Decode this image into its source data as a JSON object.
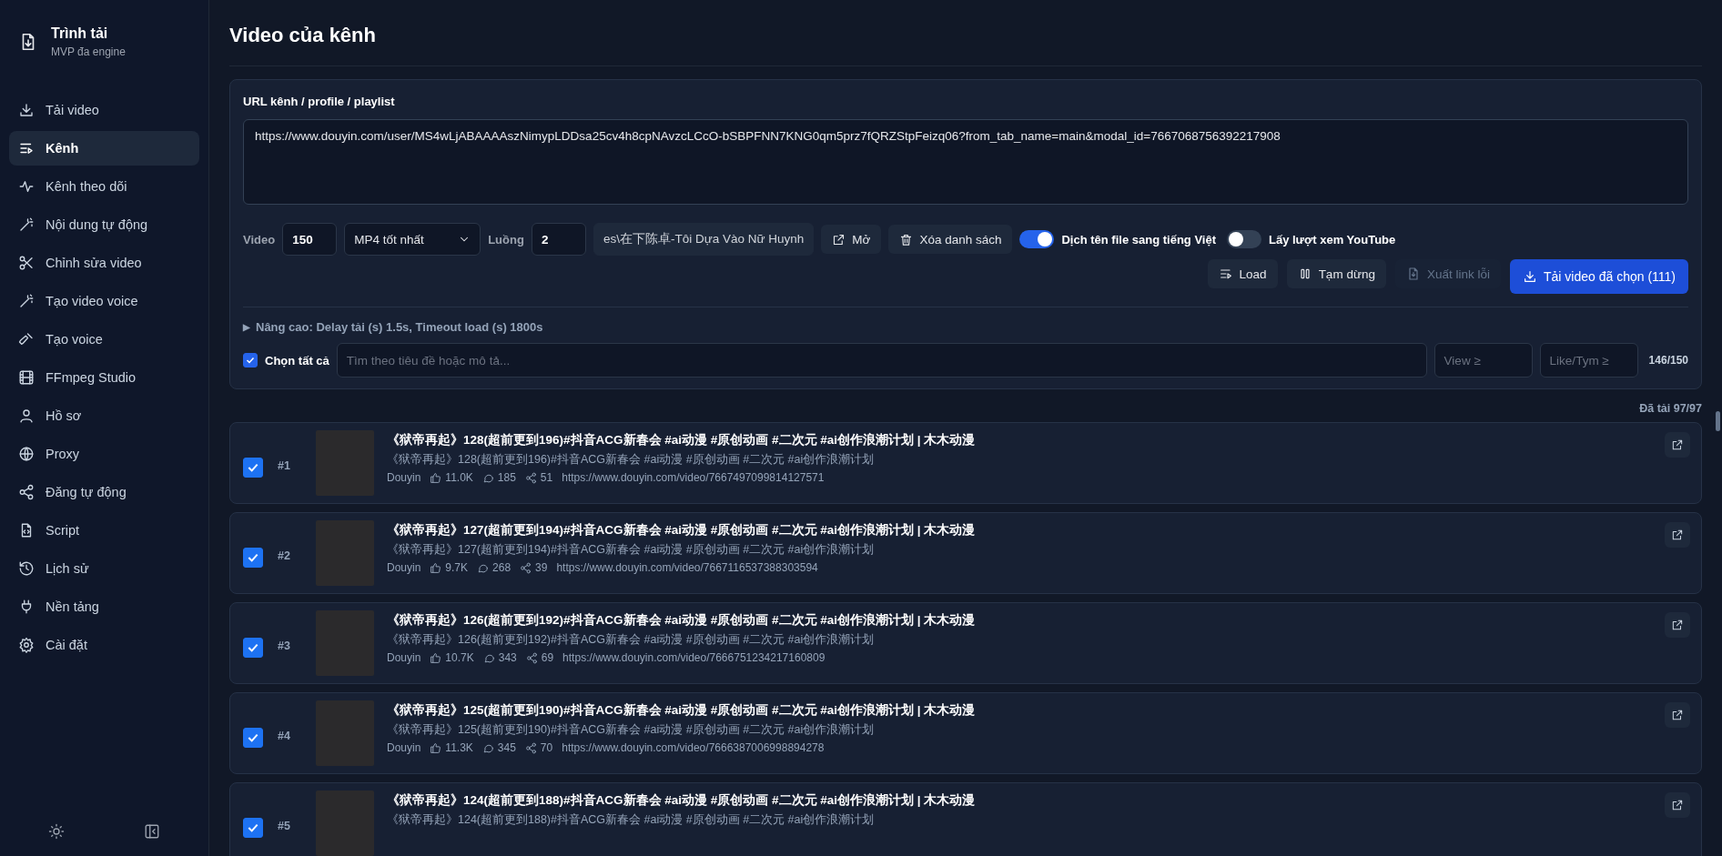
{
  "sidebar": {
    "app_title": "Trình tải",
    "app_subtitle": "MVP đa engine",
    "items": [
      {
        "label": "Tải video",
        "selected": false
      },
      {
        "label": "Kênh",
        "selected": true
      },
      {
        "label": "Kênh theo dõi",
        "selected": false
      },
      {
        "label": "Nội dung tự động",
        "selected": false
      },
      {
        "label": "Chỉnh sửa video",
        "selected": false
      },
      {
        "label": "Tạo video voice",
        "selected": false
      },
      {
        "label": "Tạo voice",
        "selected": false
      },
      {
        "label": "FFmpeg Studio",
        "selected": false
      },
      {
        "label": "Hồ sơ",
        "selected": false
      },
      {
        "label": "Proxy",
        "selected": false
      },
      {
        "label": "Đăng tự động",
        "selected": false
      },
      {
        "label": "Script",
        "selected": false
      },
      {
        "label": "Lịch sử",
        "selected": false
      },
      {
        "label": "Nền tảng",
        "selected": false
      },
      {
        "label": "Cài đặt",
        "selected": false
      }
    ]
  },
  "page_title": "Video của kênh",
  "form": {
    "url_label": "URL kênh / profile / playlist",
    "url_value": "https://www.douyin.com/user/MS4wLjABAAAAszNimypLDDsa25cv4h8cpNAvzcLCcO-bSBPFNN7KNG0qm5prz7fQRZStpFeizq06?from_tab_name=main&modal_id=7667068756392217908",
    "video_label": "Video",
    "video_value": "150",
    "format_value": "MP4 tốt nhất",
    "threads_label": "Luồng",
    "threads_value": "2",
    "folder_value": "es\\在下陈卓-Tôi Dựa Vào Nữ Huynh",
    "open_button": "Mở",
    "clear_button": "Xóa danh sách",
    "toggles": [
      {
        "label": "Dịch tên file sang tiếng Việt",
        "on": true
      },
      {
        "label": "Lấy lượt xem YouTube",
        "on": false
      }
    ],
    "actions": [
      {
        "label": "Load",
        "kind": "secondary",
        "disabled": false
      },
      {
        "label": "Tạm dừng",
        "kind": "secondary",
        "disabled": false
      },
      {
        "label": "Xuất link lỗi",
        "kind": "secondary",
        "disabled": true
      },
      {
        "label": "Tải video đã chọn (111)",
        "kind": "primary",
        "disabled": false
      }
    ],
    "advanced_marker": "▶",
    "advanced": "Nâng cao: Delay tải (s) 1.5s, Timeout load (s) 1800s",
    "select_all": {
      "label": "Chọn tất cả",
      "checked": true
    },
    "search_placeholder": "Tìm theo tiêu đề hoặc mô tả...",
    "view_placeholder": "View ≥",
    "like_placeholder": "Like/Tym ≥",
    "count": "146/150"
  },
  "loaded": "Đã tải 97/97",
  "videos": [
    {
      "checked": true,
      "index": "#1",
      "title": "《狱帝再起》128(超前更到196)#抖音ACG新春会 #ai动漫 #原创动画 #二次元 #ai创作浪潮计划 | 木木动漫",
      "description": "《狱帝再起》128(超前更到196)#抖音ACG新春会 #ai动漫 #原创动画 #二次元 #ai创作浪潮计划",
      "platform": "Douyin",
      "likes": "11.0K",
      "comments": "185",
      "shares": "51",
      "url": "https://www.douyin.com/video/7667497099814127571"
    },
    {
      "checked": true,
      "index": "#2",
      "title": "《狱帝再起》127(超前更到194)#抖音ACG新春会 #ai动漫 #原创动画 #二次元 #ai创作浪潮计划 | 木木动漫",
      "description": "《狱帝再起》127(超前更到194)#抖音ACG新春会 #ai动漫 #原创动画 #二次元 #ai创作浪潮计划",
      "platform": "Douyin",
      "likes": "9.7K",
      "comments": "268",
      "shares": "39",
      "url": "https://www.douyin.com/video/7667116537388303594"
    },
    {
      "checked": true,
      "index": "#3",
      "title": "《狱帝再起》126(超前更到192)#抖音ACG新春会 #ai动漫 #原创动画 #二次元 #ai创作浪潮计划 | 木木动漫",
      "description": "《狱帝再起》126(超前更到192)#抖音ACG新春会 #ai动漫 #原创动画 #二次元 #ai创作浪潮计划",
      "platform": "Douyin",
      "likes": "10.7K",
      "comments": "343",
      "shares": "69",
      "url": "https://www.douyin.com/video/7666751234217160809"
    },
    {
      "checked": true,
      "index": "#4",
      "title": "《狱帝再起》125(超前更到190)#抖音ACG新春会 #ai动漫 #原创动画 #二次元 #ai创作浪潮计划 | 木木动漫",
      "description": "《狱帝再起》125(超前更到190)#抖音ACG新春会 #ai动漫 #原创动画 #二次元 #ai创作浪潮计划",
      "platform": "Douyin",
      "likes": "11.3K",
      "comments": "345",
      "shares": "70",
      "url": "https://www.douyin.com/video/7666387006998894278"
    },
    {
      "checked": true,
      "index": "#5",
      "title": "《狱帝再起》124(超前更到188)#抖音ACG新春会 #ai动漫 #原创动画 #二次元 #ai创作浪潮计划 | 木木动漫",
      "description": "《狱帝再起》124(超前更到188)#抖音ACG新春会 #ai动漫 #原创动画 #二次元 #ai创作浪潮计划"
    }
  ]
}
